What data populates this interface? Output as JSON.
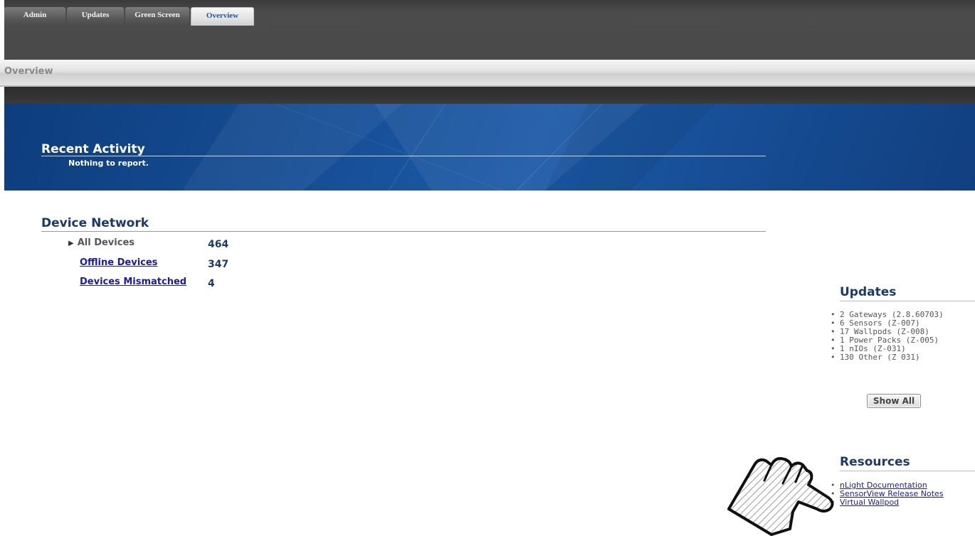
{
  "tabs": [
    {
      "label": "Admin"
    },
    {
      "label": "Updates"
    },
    {
      "label": "Green Screen"
    },
    {
      "label": "Overview",
      "active": true
    }
  ],
  "overview_bar": {
    "title": "Overview"
  },
  "recent_activity": {
    "title": "Recent Activity",
    "message": "Nothing to report."
  },
  "device_network": {
    "title": "Device Network",
    "rows": [
      {
        "label": "All Devices",
        "value": "464"
      },
      {
        "label": "Offline Devices",
        "value": "347"
      },
      {
        "label": "Devices Mismatched",
        "value": "4"
      }
    ]
  },
  "updates": {
    "title": "Updates",
    "items": [
      "2 Gateways (2.8.60703)",
      "6 Sensors (Z-007)",
      "17 Wallpods (Z-008)",
      "1 Power Packs (Z-005)",
      "1 nIOs (Z-031)",
      "130 Other (Z 031)"
    ],
    "button_label": "Show All"
  },
  "resources": {
    "title": "Resources",
    "links": [
      "nLight Documentation",
      "SensorView Release Notes",
      "Virtual Wallpod"
    ]
  },
  "colors": {
    "banner_blue": "#174f97",
    "heading_navy": "#1a3a6b",
    "link_blue": "#1a1aa8"
  },
  "icons": {
    "pointer": "pointing-hand-icon",
    "expand": "triangle-right-icon"
  }
}
